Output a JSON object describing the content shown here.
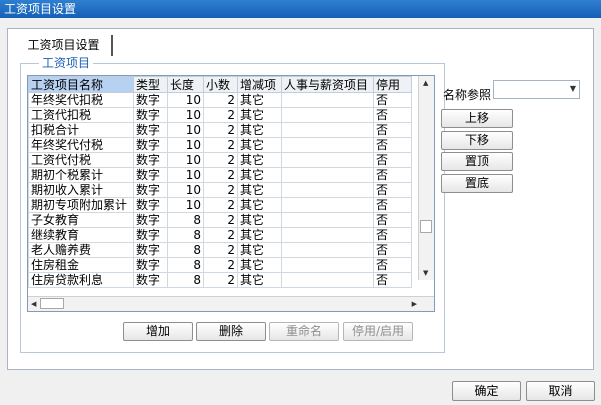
{
  "window": {
    "title": "工资项目设置"
  },
  "tab": {
    "label": "工资项目设置"
  },
  "group": {
    "legend": "工资项目"
  },
  "table": {
    "headers": [
      "工资项目名称",
      "类型",
      "长度",
      "小数",
      "增减项",
      "人事与薪资项目",
      "停用"
    ],
    "rows": [
      [
        "年终奖代扣税",
        "数字",
        "10",
        "2",
        "其它",
        "",
        "否"
      ],
      [
        "工资代扣税",
        "数字",
        "10",
        "2",
        "其它",
        "",
        "否"
      ],
      [
        "扣税合计",
        "数字",
        "10",
        "2",
        "其它",
        "",
        "否"
      ],
      [
        "年终奖代付税",
        "数字",
        "10",
        "2",
        "其它",
        "",
        "否"
      ],
      [
        "工资代付税",
        "数字",
        "10",
        "2",
        "其它",
        "",
        "否"
      ],
      [
        "期初个税累计",
        "数字",
        "10",
        "2",
        "其它",
        "",
        "否"
      ],
      [
        "期初收入累计",
        "数字",
        "10",
        "2",
        "其它",
        "",
        "否"
      ],
      [
        "期初专项附加累计",
        "数字",
        "10",
        "2",
        "其它",
        "",
        "否"
      ],
      [
        "子女教育",
        "数字",
        "8",
        "2",
        "其它",
        "",
        "否"
      ],
      [
        "继续教育",
        "数字",
        "8",
        "2",
        "其它",
        "",
        "否"
      ],
      [
        "老人赡养费",
        "数字",
        "8",
        "2",
        "其它",
        "",
        "否"
      ],
      [
        "住房租金",
        "数字",
        "8",
        "2",
        "其它",
        "",
        "否"
      ],
      [
        "住房贷款利息",
        "数字",
        "8",
        "2",
        "其它",
        "",
        "否"
      ]
    ]
  },
  "side": {
    "name_ref_label": "名称参照",
    "name_ref_value": "",
    "move_up": "上移",
    "move_down": "下移",
    "top": "置顶",
    "bottom": "置底"
  },
  "actions": {
    "add": "增加",
    "delete": "删除",
    "rename": "重命名",
    "toggle": "停用/启用"
  },
  "footer": {
    "ok": "确定",
    "cancel": "取消"
  }
}
